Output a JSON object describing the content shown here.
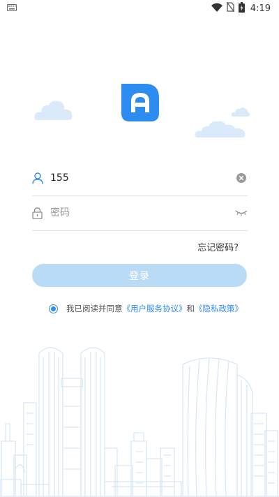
{
  "status_bar": {
    "time": "4:19",
    "icons": [
      "keyboard-icon",
      "wifi-icon",
      "no-sim-icon",
      "battery-charging-icon"
    ]
  },
  "app": {
    "logo_icon": "app-logo-A"
  },
  "login": {
    "phone_value": "155",
    "password_placeholder": "密码",
    "forgot_password": "忘记密码?",
    "login_button": "登录"
  },
  "agreement": {
    "checked": true,
    "prefix": "我已阅读并同意",
    "user_agreement": "《用户服务协议》",
    "and": "和",
    "privacy_policy": "《隐私政策》"
  },
  "colors": {
    "brand": "#2d8cf0",
    "button_disabled": "#b9dbf6",
    "cloud": "#dbeafa",
    "city_line": "#d9e8f6"
  }
}
